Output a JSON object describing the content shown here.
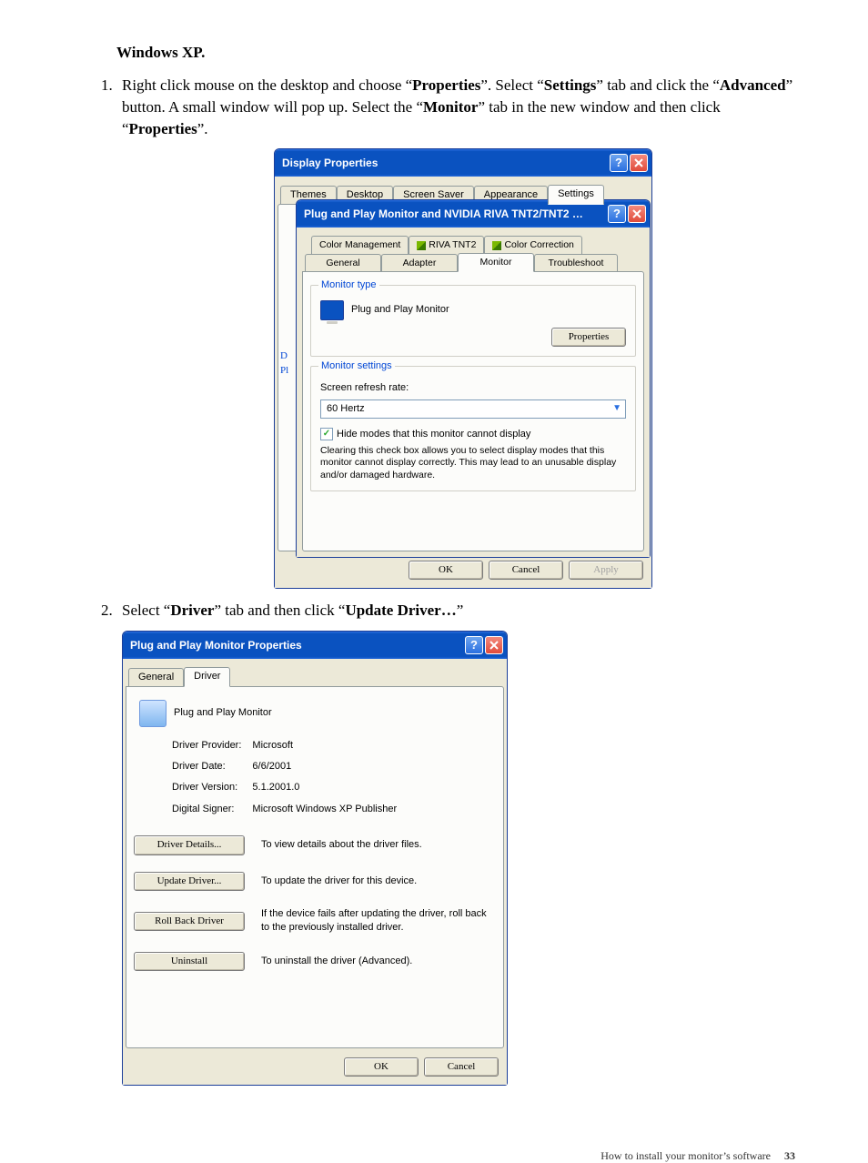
{
  "doc": {
    "heading": "Windows XP.",
    "step1_a": "Right click mouse on the desktop and choose “",
    "step1_b": "”. Select “",
    "step1_c": "” tab and click the “",
    "step1_d": "” button. A small window will pop up. Select the “",
    "step1_e": "” tab in the new window and then click “",
    "step1_f": "”.",
    "s1_properties": "Properties",
    "s1_settings": "Settings",
    "s1_advanced": "Advanced",
    "s1_monitor": "Monitor",
    "s1_properties2": "Properties",
    "step2_a": "Select “",
    "step2_b": "” tab and then click “",
    "step2_c": "”",
    "s2_driver": "Driver",
    "s2_update": "Update Driver…",
    "footer": "How to install your monitor’s software",
    "page_no": "33"
  },
  "win1": {
    "outer_title": "Display Properties",
    "tabs_outer": [
      "Themes",
      "Desktop",
      "Screen Saver",
      "Appearance",
      "Settings"
    ],
    "gutter_d": "D",
    "gutter_p": "Pl",
    "inner_title": "Plug and Play Monitor and NVIDIA RIVA TNT2/TNT2 P...",
    "tabs_inner_row1": [
      "Color Management",
      "RIVA TNT2",
      "Color Correction"
    ],
    "tabs_inner_row2": [
      "General",
      "Adapter",
      "Monitor",
      "Troubleshoot"
    ],
    "grp_monitor_type": "Monitor type",
    "monitor_name": "Plug and Play Monitor",
    "btn_properties": "Properties",
    "grp_monitor_settings": "Monitor settings",
    "lbl_refresh": "Screen refresh rate:",
    "refresh_value": "60 Hertz",
    "chk_hide": "Hide modes that this monitor cannot display",
    "hide_note": "Clearing this check box allows you to select display modes that this monitor cannot display correctly. This may lead to an unusable display and/or damaged hardware.",
    "ok": "OK",
    "cancel": "Cancel",
    "apply": "Apply"
  },
  "win2": {
    "title": "Plug and Play Monitor Properties",
    "tabs": [
      "General",
      "Driver"
    ],
    "device_name": "Plug and Play Monitor",
    "provider_lbl": "Driver Provider:",
    "provider_val": "Microsoft",
    "date_lbl": "Driver Date:",
    "date_val": "6/6/2001",
    "version_lbl": "Driver Version:",
    "version_val": "5.1.2001.0",
    "signer_lbl": "Digital Signer:",
    "signer_val": "Microsoft Windows XP Publisher",
    "btn_details": "Driver Details...",
    "desc_details": "To view details about the driver files.",
    "btn_update": "Update Driver...",
    "desc_update": "To update the driver for this device.",
    "btn_rollback": "Roll Back Driver",
    "desc_rollback": "If the device fails after updating the driver, roll back to the previously installed driver.",
    "btn_uninstall": "Uninstall",
    "desc_uninstall": "To uninstall the driver (Advanced).",
    "ok": "OK",
    "cancel": "Cancel"
  }
}
